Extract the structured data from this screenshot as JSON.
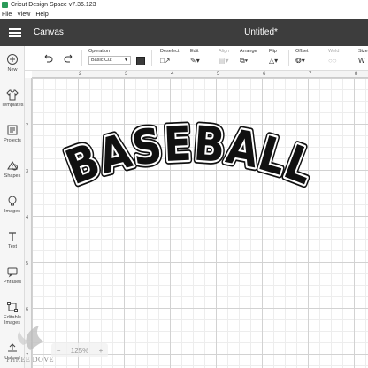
{
  "window": {
    "title": "Cricut Design Space  v7.36.123"
  },
  "menu": {
    "items": [
      "File",
      "View",
      "Help"
    ]
  },
  "header": {
    "section": "Canvas",
    "doc_title": "Untitled*"
  },
  "sidebar": {
    "items": [
      {
        "label": "New",
        "icon": "plus-circle-icon"
      },
      {
        "label": "Templates",
        "icon": "shirt-icon"
      },
      {
        "label": "Projects",
        "icon": "projects-icon"
      },
      {
        "label": "Shapes",
        "icon": "shapes-icon"
      },
      {
        "label": "Images",
        "icon": "lightbulb-icon"
      },
      {
        "label": "Text",
        "icon": "text-icon"
      },
      {
        "label": "Phrases",
        "icon": "phrases-icon"
      },
      {
        "label": "Editable Images",
        "icon": "editable-images-icon"
      },
      {
        "label": "Upload",
        "icon": "upload-icon"
      }
    ]
  },
  "toolbar": {
    "operation_label": "Operation",
    "operation_value": "Basic Cut",
    "deselect_label": "Deselect",
    "edit_label": "Edit",
    "align_label": "Align",
    "arrange_label": "Arrange",
    "flip_label": "Flip",
    "offset_label": "Offset",
    "weld_label": "Weld",
    "size_label": "Size",
    "swatch_color": "#3b3b3b"
  },
  "rulers": {
    "top": [
      "2",
      "3",
      "4",
      "5",
      "6",
      "7",
      "8"
    ],
    "left": [
      "2",
      "3",
      "4",
      "5",
      "6",
      "7"
    ]
  },
  "design": {
    "text": "BASEBALL",
    "fill": "#111111",
    "outline": "#ffffff"
  },
  "zoom": {
    "value": "125%",
    "minus": "−",
    "plus": "+"
  },
  "watermark": {
    "text": "THREE DOVE"
  }
}
